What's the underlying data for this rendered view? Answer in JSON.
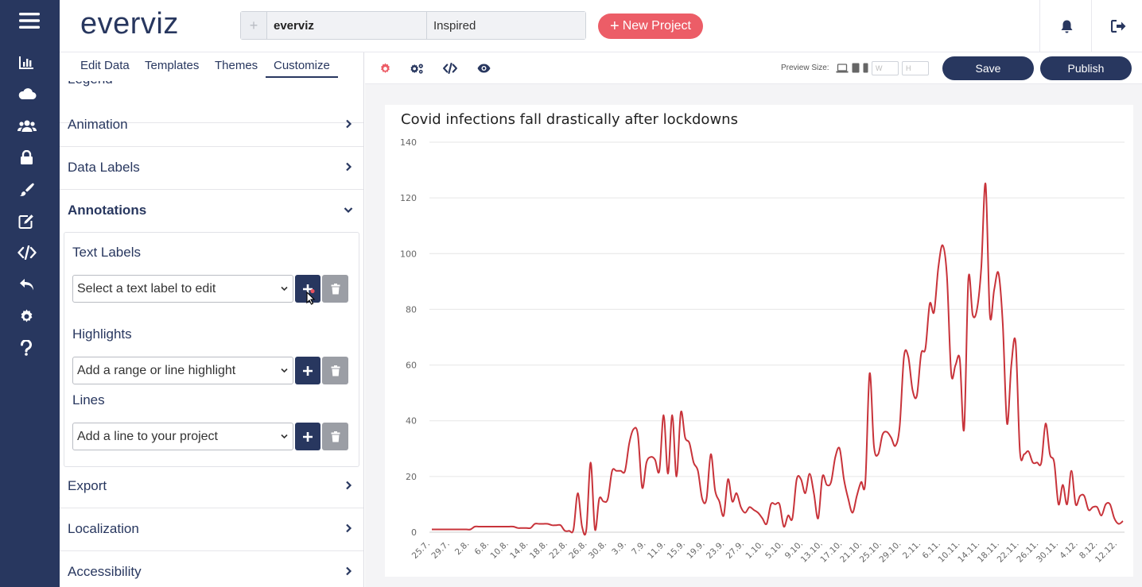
{
  "header": {
    "logo_main": "everviz",
    "project_name": "everviz",
    "project_theme": "Inspired",
    "new_project_label": "New Project"
  },
  "tabs": [
    {
      "label": "Edit Data"
    },
    {
      "label": "Templates"
    },
    {
      "label": "Themes"
    },
    {
      "label": "Customize",
      "active": true
    }
  ],
  "sections": {
    "legend": "Legend",
    "animation": "Animation",
    "data_labels": "Data Labels",
    "annotations": "Annotations",
    "export": "Export",
    "localization": "Localization",
    "accessibility": "Accessibility"
  },
  "annotations": {
    "text_labels_title": "Text Labels",
    "text_labels_select": "Select a text label to edit",
    "highlights_title": "Highlights",
    "highlights_select": "Add a range or line highlight",
    "lines_title": "Lines",
    "lines_select": "Add a line to your project"
  },
  "toolbar": {
    "preview_label": "Preview Size:",
    "width_placeholder": "W",
    "height_placeholder": "H",
    "save_label": "Save",
    "publish_label": "Publish"
  },
  "colors": {
    "navy": "#28375f",
    "accent": "#ec5d67",
    "series": "#c8333a"
  },
  "chart_data": {
    "type": "line",
    "title": "Covid infections fall drastically after lockdowns",
    "xlabel": "",
    "ylabel": "",
    "ylim": [
      0,
      140
    ],
    "yticks": [
      0,
      20,
      40,
      60,
      80,
      100,
      120,
      140
    ],
    "grid": true,
    "x_tick_labels": [
      "25.7.",
      "29.7.",
      "2.8.",
      "6.8.",
      "10.8.",
      "14.8.",
      "18.8.",
      "22.8.",
      "26.8.",
      "30.8.",
      "3.9.",
      "7.9.",
      "11.9.",
      "15.9.",
      "19.9.",
      "23.9.",
      "27.9.",
      "1.10.",
      "5.10.",
      "9.10.",
      "13.10.",
      "17.10.",
      "21.10.",
      "25.10.",
      "29.10.",
      "2.11.",
      "6.11.",
      "10.11.",
      "14.11.",
      "18.11.",
      "22.11.",
      "26.11.",
      "30.11.",
      "4.12.",
      "8.12.",
      "12.12."
    ],
    "series": [
      {
        "color": "#c8333a",
        "values": [
          1,
          1,
          1,
          1,
          1,
          1,
          1,
          1,
          1,
          1,
          2,
          2,
          2,
          2,
          2,
          2,
          2,
          2,
          2,
          2,
          1.5,
          1.5,
          1.5,
          1.5,
          3,
          3,
          3,
          3,
          2.5,
          2.5,
          2.5,
          0.5,
          0.5,
          1,
          14,
          2,
          1,
          25,
          1,
          12,
          11,
          12,
          22,
          22,
          22,
          22,
          32,
          37,
          35,
          16,
          25,
          27,
          26,
          22,
          42,
          21,
          42,
          20,
          43,
          34,
          32,
          25,
          22,
          12,
          12,
          28,
          15,
          11,
          6,
          19,
          11,
          14,
          9,
          7,
          9,
          8,
          7,
          5,
          3,
          10,
          10,
          10,
          2,
          6,
          5,
          19,
          19,
          14,
          21,
          14,
          5,
          20,
          17,
          18,
          27,
          30,
          19,
          12,
          7,
          13,
          18,
          18,
          57,
          31,
          28,
          35,
          36,
          34,
          31,
          38,
          63,
          63,
          51,
          49,
          64,
          66,
          82,
          79,
          95,
          103,
          92,
          57,
          60,
          62,
          37,
          91,
          78,
          80,
          95,
          125,
          78,
          87,
          93,
          75,
          39,
          60,
          68,
          29,
          28,
          29,
          25,
          25,
          25,
          39,
          28,
          25,
          10,
          17,
          10,
          22,
          10,
          13,
          13,
          8,
          9,
          9,
          6,
          10,
          10,
          5,
          3,
          4
        ]
      }
    ]
  }
}
